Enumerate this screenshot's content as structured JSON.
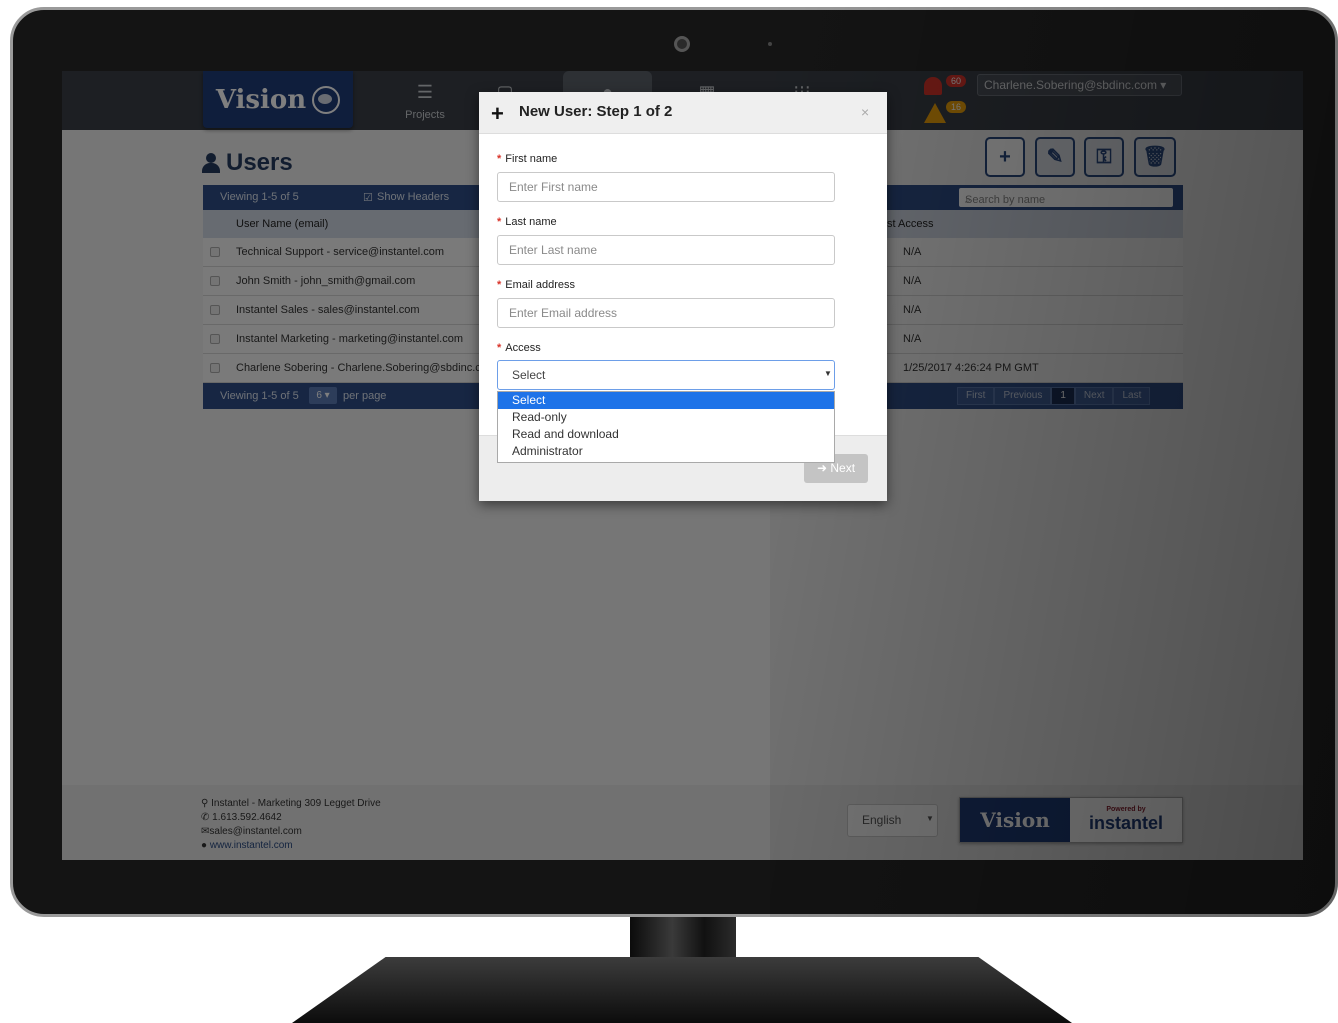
{
  "nav": {
    "projects": "Projects"
  },
  "alerts": {
    "count_red": "60",
    "count_yellow": "16"
  },
  "user": {
    "menu_label": "Charlene.Sobering@sbdinc.com ▾"
  },
  "page": {
    "title": "Users"
  },
  "table": {
    "viewing_top": "Viewing 1-5 of 5",
    "show_headers": "Show Headers",
    "search_placeholder": "Search by name",
    "col_username": "User Name (email)",
    "col_last_access": "st Access",
    "rows": [
      {
        "name": "Technical Support - service@instantel.com",
        "last": "N/A"
      },
      {
        "name": "John Smith - john_smith@gmail.com",
        "last": "N/A"
      },
      {
        "name": "Instantel Sales - sales@instantel.com",
        "last": "N/A"
      },
      {
        "name": "Instantel Marketing - marketing@instantel.com",
        "last": "N/A"
      },
      {
        "name": "Charlene Sobering - Charlene.Sobering@sbdinc.c",
        "last": "1/25/2017 4:26:24 PM GMT"
      }
    ],
    "viewing_bottom": "Viewing 1-5 of 5",
    "per_page_value": "6 ▾",
    "per_page_label": "per page",
    "pager": {
      "first": "First",
      "previous": "Previous",
      "current": "1",
      "next": "Next",
      "last": "Last"
    }
  },
  "footer": {
    "address": "Instantel - Marketing 309 Legget Drive",
    "phone": "1.613.592.4642",
    "email": "sales@instantel.com",
    "website": "www.instantel.com",
    "language": "English",
    "powered_by": "Powered by",
    "instantel_logo": "instantel",
    "vision_logo": "Vision"
  },
  "brand": {
    "logo_text": "Vision"
  },
  "modal": {
    "title": "New User: Step 1 of 2",
    "close": "×",
    "first_name_label": "First name",
    "first_name_placeholder": "Enter First name",
    "last_name_label": "Last name",
    "last_name_placeholder": "Enter Last name",
    "email_label": "Email address",
    "email_placeholder": "Enter Email address",
    "access_label": "Access",
    "access_value": "Select",
    "access_options": [
      "Select",
      "Read-only",
      "Read and download",
      "Administrator"
    ],
    "next_label": "➜ Next"
  }
}
